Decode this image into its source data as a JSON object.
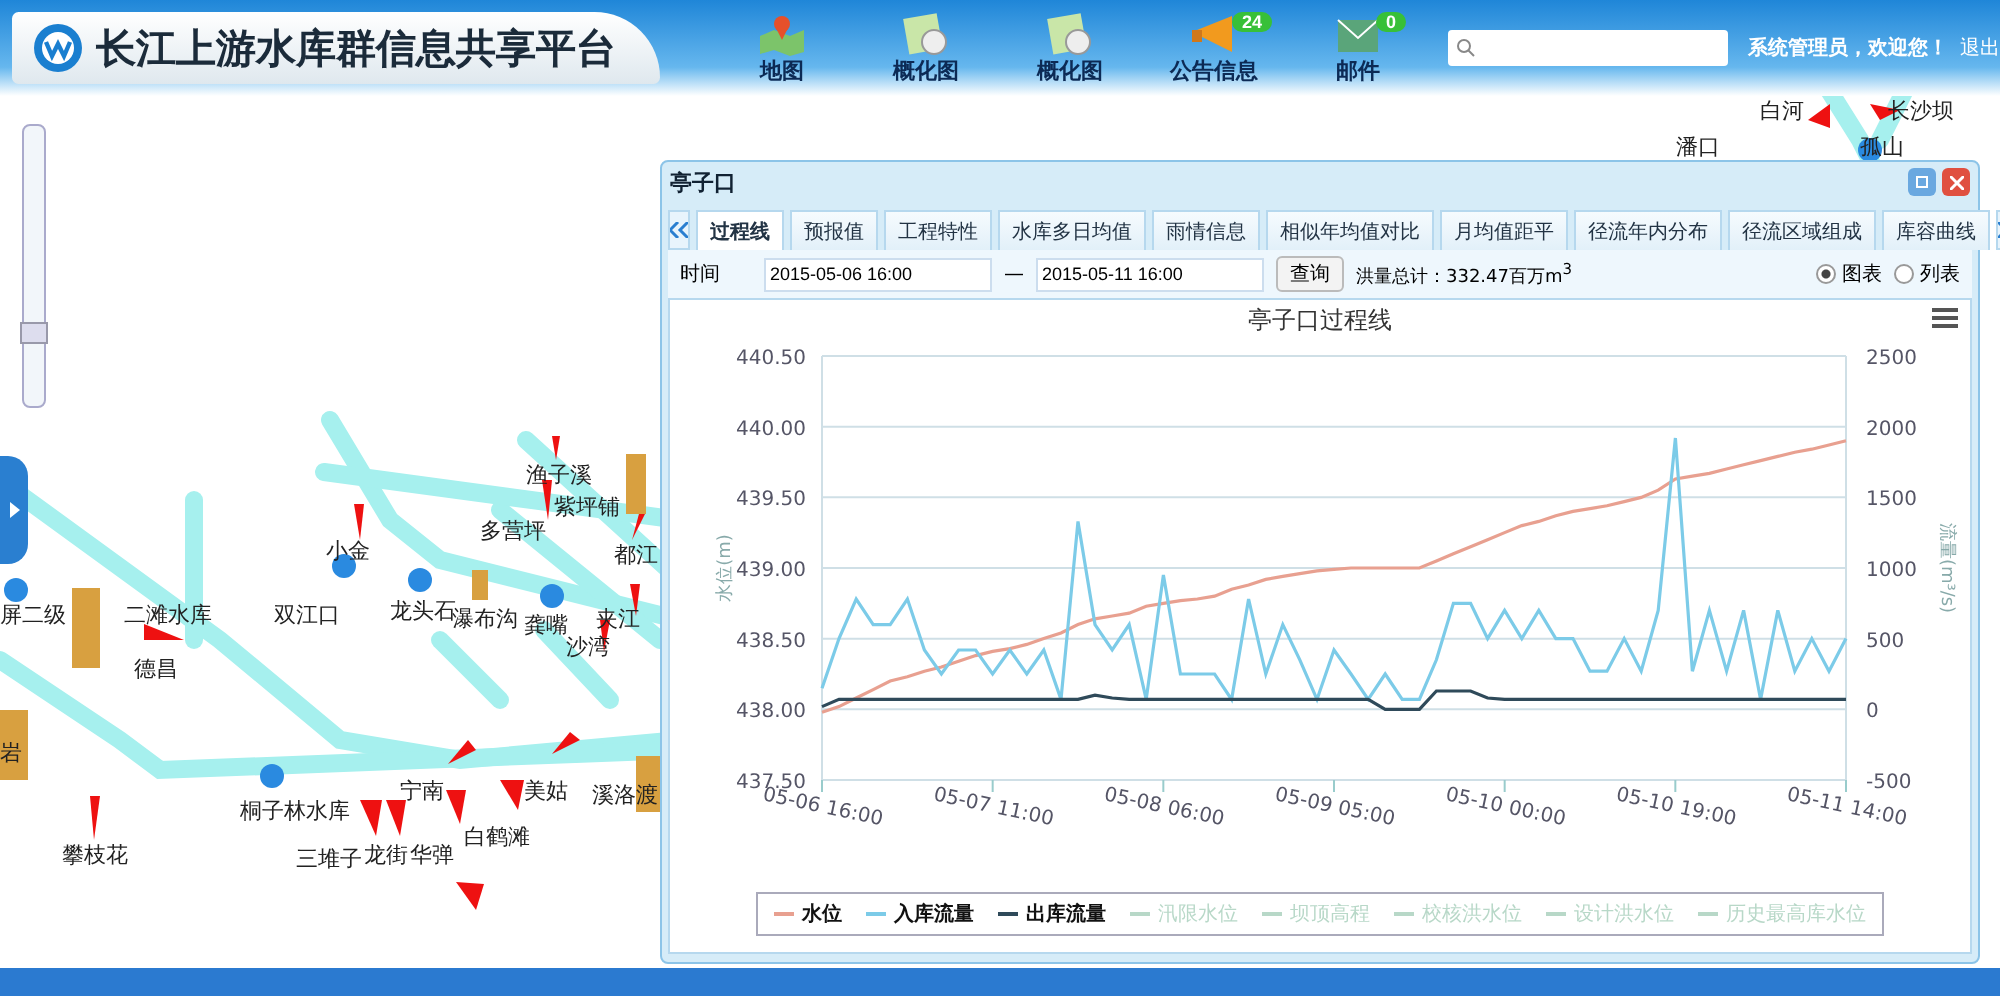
{
  "header": {
    "title": "长江上游水库群信息共享平台",
    "nav": [
      {
        "label": "地图",
        "kind": "map"
      },
      {
        "label": "概化图",
        "kind": "diagram"
      },
      {
        "label": "概化图",
        "kind": "diagram"
      },
      {
        "label": "公告信息",
        "kind": "notice",
        "badge": "24"
      },
      {
        "label": "邮件",
        "kind": "mail",
        "badge": "0"
      }
    ],
    "user": "系统管理员，欢迎您！",
    "logout": "退出"
  },
  "map": {
    "zoom_slider": {
      "level": 0.25
    },
    "labels": [
      "白河",
      "长沙坝",
      "潘口",
      "孤山",
      "渔子溪",
      "紫坪铺",
      "多营坪",
      "小金",
      "都江",
      "屏二级",
      "二滩水库",
      "双江口",
      "龙头石",
      "瀑布沟",
      "龚嘴",
      "夹江",
      "沙湾",
      "德昌",
      "岩",
      "宁南",
      "美姑",
      "溪洛渡",
      "桐子林水库",
      "白鹤滩",
      "攀枝花",
      "三堆子",
      "龙街",
      "华弹"
    ]
  },
  "window": {
    "title": "亭子口",
    "tabs": [
      {
        "label": "过程线",
        "selected": true
      },
      {
        "label": "预报值",
        "selected": false
      },
      {
        "label": "工程特性",
        "selected": false
      },
      {
        "label": "水库多日均值",
        "selected": false
      },
      {
        "label": "雨情信息",
        "selected": false
      },
      {
        "label": "相似年均值对比",
        "selected": false
      },
      {
        "label": "月均值距平",
        "selected": false
      },
      {
        "label": "径流年内分布",
        "selected": false
      },
      {
        "label": "径流区域组成",
        "selected": false
      },
      {
        "label": "库容曲线",
        "selected": false
      }
    ],
    "time_label": "时间",
    "start": "2015-05-06 16:00",
    "separator": "—",
    "end": "2015-05-11 16:00",
    "query": "查询",
    "total": "洪量总计：332.47百万m$^{3}$",
    "views": [
      {
        "label": "图表",
        "selected": true
      },
      {
        "label": "列表",
        "selected": false
      }
    ],
    "chart_data": {
      "type": "line",
      "grid": true,
      "title": "亭子口过程线",
      "ylabel": "水位(m)",
      "y2label": "流量(m³/s)",
      "ylim": [
        437.5,
        440.5
      ],
      "categories": [
        "05-06 16:00",
        null,
        null,
        null,
        null,
        null,
        null,
        null,
        null,
        null,
        "05-07 11:00",
        null,
        null,
        null,
        null,
        null,
        null,
        null,
        null,
        null,
        "05-08 06:00",
        null,
        null,
        null,
        null,
        null,
        null,
        null,
        null,
        null,
        "05-09 05:00",
        null,
        null,
        null,
        null,
        null,
        null,
        null,
        null,
        null,
        "05-10 00:00",
        null,
        null,
        null,
        null,
        null,
        null,
        null,
        null,
        null,
        "05-10 19:00",
        null,
        null,
        null,
        null,
        null,
        null,
        null,
        null,
        null,
        "05-11 14:00"
      ],
      "yticks": [
        {
          "value": 437.5,
          "label": "437.50"
        },
        {
          "value": 438,
          "label": "438.00"
        },
        {
          "value": 438.5,
          "label": "438.50"
        },
        {
          "value": 439,
          "label": "439.00"
        },
        {
          "value": 439.5,
          "label": "439.50"
        },
        {
          "value": 440,
          "label": "440.00"
        },
        {
          "value": 440.5,
          "label": "440.50"
        }
      ],
      "y2lim": [
        -500,
        2500
      ],
      "y2ticks": [
        -500,
        0,
        500,
        1000,
        1500,
        2000,
        2500
      ],
      "series": [
        {
          "name": "水位",
          "color": "#e8a090",
          "values": [
            437.98,
            438.02,
            438.08,
            438.14,
            438.2,
            438.23,
            438.27,
            438.3,
            438.34,
            438.38,
            438.41,
            438.43,
            438.46,
            438.5,
            438.54,
            438.6,
            438.64,
            438.66,
            438.68,
            438.73,
            438.75,
            438.77,
            438.78,
            438.8,
            438.85,
            438.88,
            438.92,
            438.94,
            438.96,
            438.98,
            438.99,
            439.0,
            439.0,
            439.0,
            439.0,
            439.0,
            439.05,
            439.1,
            439.15,
            439.2,
            439.25,
            439.3,
            439.33,
            439.37,
            439.4,
            439.42,
            439.44,
            439.47,
            439.5,
            439.55,
            439.63,
            439.65,
            439.67,
            439.7,
            439.73,
            439.76,
            439.79,
            439.82,
            439.84,
            439.87,
            439.9
          ]
        },
        {
          "name": "入库流量",
          "color": "#7ccbe8",
          "axis": "y2",
          "values": [
            150,
            500,
            780,
            600,
            600,
            780,
            420,
            250,
            420,
            420,
            250,
            420,
            250,
            420,
            70,
            1330,
            600,
            420,
            600,
            70,
            950,
            250,
            250,
            250,
            70,
            780,
            250,
            600,
            350,
            70,
            420,
            250,
            70,
            250,
            70,
            70,
            350,
            750,
            750,
            500,
            700,
            500,
            700,
            500,
            500,
            270,
            270,
            500,
            270,
            700,
            1920,
            270,
            700,
            270,
            700,
            70,
            700,
            270,
            500,
            270,
            500
          ]
        },
        {
          "name": "出库流量",
          "color": "#2f4a5a",
          "axis": "y2",
          "values": [
            20,
            70,
            70,
            70,
            70,
            70,
            70,
            70,
            70,
            70,
            70,
            70,
            70,
            70,
            70,
            70,
            100,
            80,
            70,
            70,
            70,
            70,
            70,
            70,
            70,
            70,
            70,
            70,
            70,
            70,
            70,
            70,
            70,
            0,
            0,
            0,
            130,
            130,
            130,
            80,
            70,
            70,
            70,
            70,
            70,
            70,
            70,
            70,
            70,
            70,
            70,
            70,
            70,
            70,
            70,
            70,
            70,
            70,
            70,
            70,
            70
          ]
        }
      ]
    },
    "hidden_legend": [
      "汛限水位",
      "坝顶高程",
      "校核洪水位",
      "设计洪水位",
      "历史最高库水位"
    ]
  }
}
